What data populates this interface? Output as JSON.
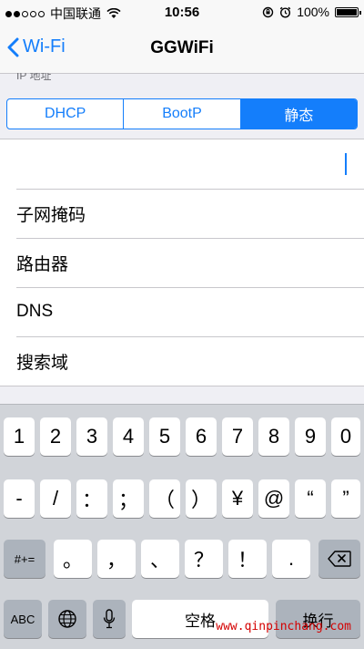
{
  "status_bar": {
    "carrier": "中国联通",
    "time": "10:56",
    "battery": "100%"
  },
  "nav": {
    "back_label": "Wi-Fi",
    "title": "GGWiFi"
  },
  "section_label": "IP 地址",
  "segments": [
    {
      "label": "DHCP",
      "active": false
    },
    {
      "label": "BootP",
      "active": false
    },
    {
      "label": "静态",
      "active": true
    }
  ],
  "fields": [
    {
      "label": ""
    },
    {
      "label": "子网掩码"
    },
    {
      "label": "路由器"
    },
    {
      "label": "DNS"
    },
    {
      "label": "搜索域"
    }
  ],
  "keyboard": {
    "row1": [
      "1",
      "2",
      "3",
      "4",
      "5",
      "6",
      "7",
      "8",
      "9",
      "0"
    ],
    "row2": [
      "-",
      "/",
      "：",
      "；",
      "（",
      "）",
      "¥",
      "@",
      "“",
      "”"
    ],
    "row3_left": "#+=",
    "row3": [
      "。",
      "，",
      "、",
      "？",
      "！",
      "."
    ],
    "row4": {
      "abc": "ABC",
      "space": "空格",
      "return": "换行"
    }
  },
  "watermark": "www.qinpinchang.com",
  "colors": {
    "accent": "#147efb",
    "background": "#efeff4",
    "keyboard_bg": "#d1d4d9",
    "watermark": "#d40000"
  }
}
